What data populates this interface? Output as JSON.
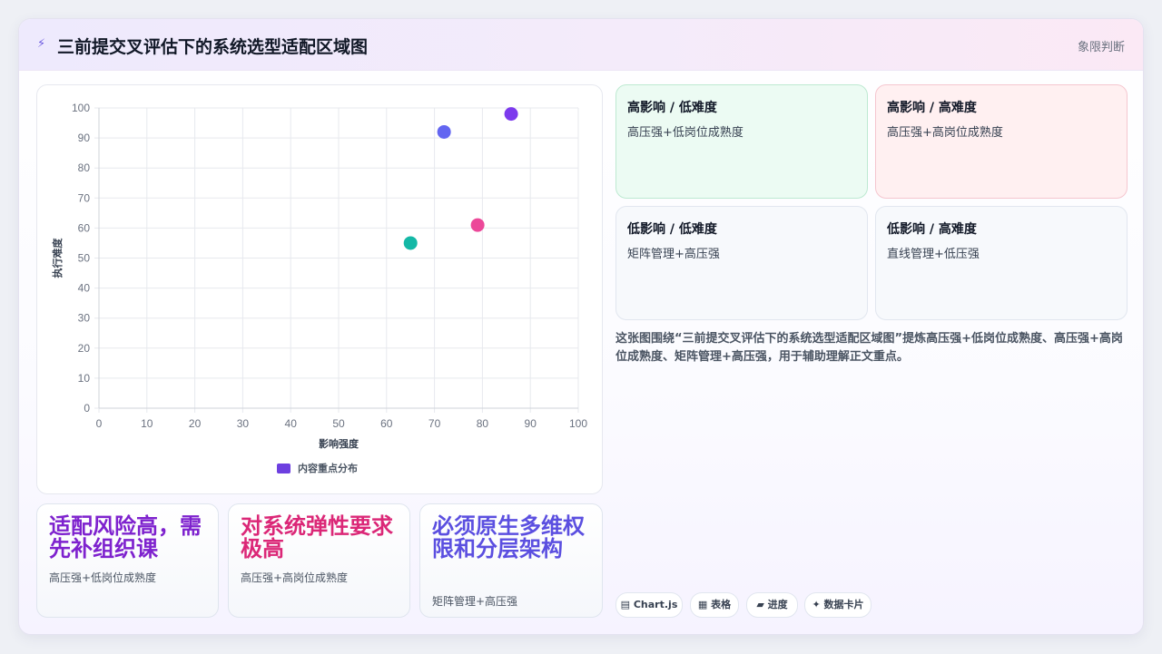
{
  "header": {
    "icon": "lightning-icon",
    "title": "三前提交叉评估下的系统选型适配区域图",
    "tag": "象限判断"
  },
  "chart_data": {
    "type": "scatter",
    "xlabel": "影响强度",
    "ylabel": "执行难度",
    "xlim": [
      0,
      100
    ],
    "ylim": [
      0,
      100
    ],
    "xticks": [
      "0",
      "10",
      "20",
      "30",
      "40",
      "50",
      "60",
      "70",
      "80",
      "90",
      "100"
    ],
    "yticks": [
      "0",
      "10",
      "20",
      "30",
      "40",
      "50",
      "60",
      "70",
      "80",
      "90",
      "100"
    ],
    "grid": true,
    "legend": {
      "position": "bottom",
      "label": "内容重点分布",
      "color": "#6d3fe0"
    },
    "points": [
      {
        "x": 86,
        "y": 98,
        "color": "#7c3aed"
      },
      {
        "x": 72,
        "y": 92,
        "color": "#6366f1"
      },
      {
        "x": 79,
        "y": 61,
        "color": "#ec4899"
      },
      {
        "x": 65,
        "y": 55,
        "color": "#14b8a6"
      }
    ]
  },
  "stats": [
    {
      "title": "适配风险高，需先补组织课",
      "sub": "高压强+低岗位成熟度",
      "color": "#7e22ce"
    },
    {
      "title": "对系统弹性要求极高",
      "sub": "高压强+高岗位成熟度",
      "color": "#db2777"
    },
    {
      "title": "必须原生多维权限和分层架构",
      "sub": "矩阵管理+高压强",
      "color": "#5b4fe0"
    }
  ],
  "quadrants": [
    {
      "title": "高影响 / 低难度",
      "sub": "高压强+低岗位成熟度",
      "bg": "#ecfbf3",
      "border": "#bde9d1"
    },
    {
      "title": "高影响 / 高难度",
      "sub": "高压强+高岗位成熟度",
      "bg": "#fff0f1",
      "border": "#f5c6cf"
    },
    {
      "title": "低影响 / 低难度",
      "sub": "矩阵管理+高压强",
      "bg": "#f7f9fc",
      "border": "#e1e6ef"
    },
    {
      "title": "低影响 / 高难度",
      "sub": "直线管理+低压强",
      "bg": "#f7f9fc",
      "border": "#e1e6ef"
    }
  ],
  "description": "这张图围绕“三前提交叉评估下的系统选型适配区域图”提炼高压强+低岗位成熟度、高压强+高岗位成熟度、矩阵管理+高压强，用于辅助理解正文重点。",
  "chips": [
    {
      "icon": "chart-icon",
      "label": "Chart.js",
      "glyph": "▤"
    },
    {
      "icon": "table-icon",
      "label": "表格",
      "glyph": "▦"
    },
    {
      "icon": "progress-icon",
      "label": "进度",
      "glyph": "▰"
    },
    {
      "icon": "sparkle-icon",
      "label": "数据卡片",
      "glyph": "✦"
    }
  ]
}
